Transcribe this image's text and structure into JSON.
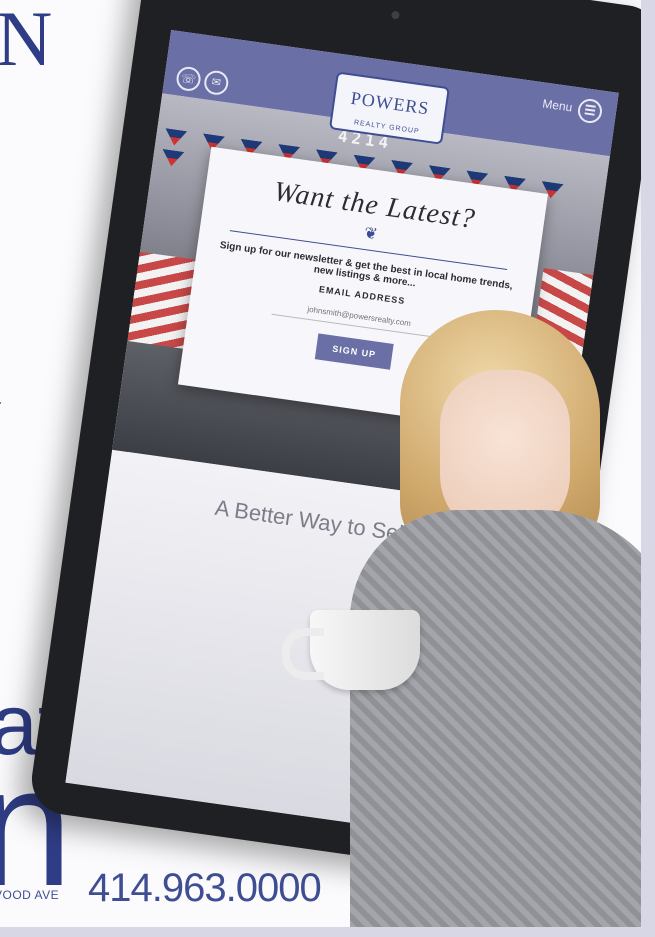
{
  "print": {
    "heading_fragment": "N",
    "side_fragment_1": "r",
    "side_fragment_2": ".",
    "large_word_1": "at",
    "large_word_2": "n",
    "address": "VOOD AVE",
    "phone": "414.963.0000"
  },
  "tablet_site": {
    "menu_label": "Menu",
    "logo": {
      "name": "POWERS",
      "sub": "REALTY GROUP"
    },
    "house_number": "4214",
    "modal": {
      "title": "Want the Latest?",
      "description": "Sign up for our newsletter & get the best in local home trends, new listings & more...",
      "email_label": "EMAIL ADDRESS",
      "email_placeholder": "johnsmith@powersrealty.com",
      "button_label": "SIGN UP"
    },
    "tagline": "A Better Way to Sell"
  },
  "colors": {
    "brand": "#3f4e93",
    "nav": "#6a6fa6"
  }
}
